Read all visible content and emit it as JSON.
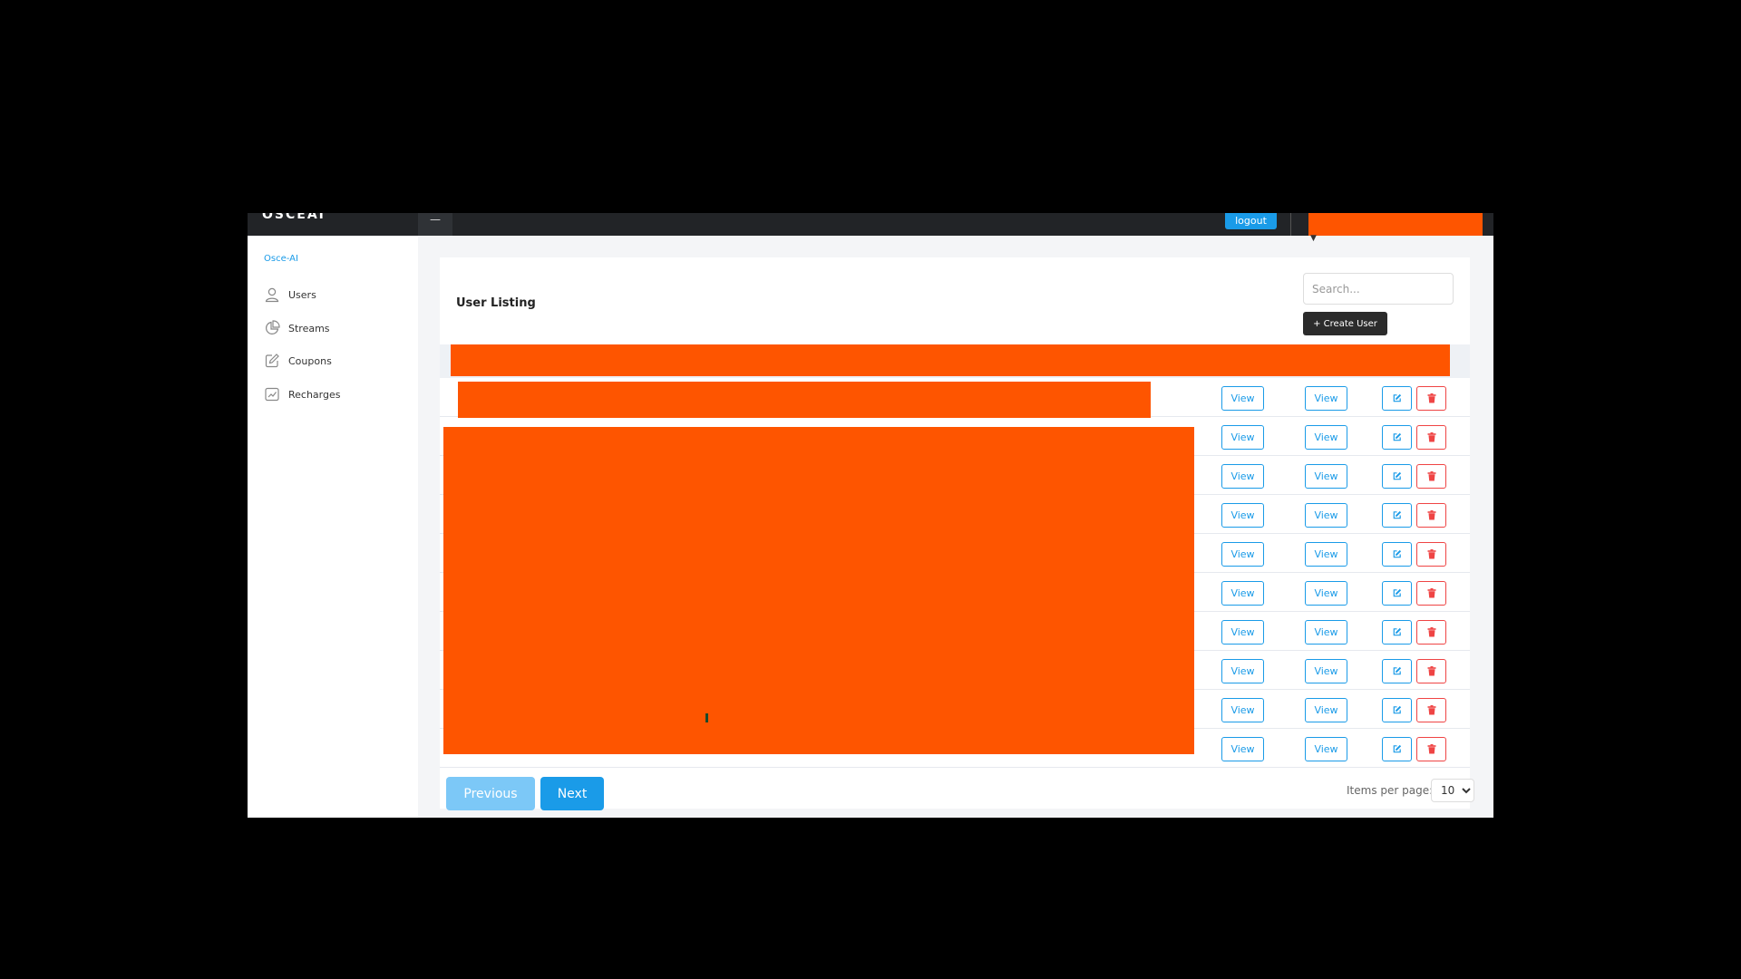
{
  "topbar": {
    "logo": "OSCEAI",
    "menu_icon": "hamburger-icon",
    "logout_label": "logout"
  },
  "sidebar": {
    "brand": "Osce-AI",
    "items": [
      {
        "label": "Users",
        "icon": "user-icon"
      },
      {
        "label": "Streams",
        "icon": "pie-chart-icon"
      },
      {
        "label": "Coupons",
        "icon": "edit-icon"
      },
      {
        "label": "Recharges",
        "icon": "chart-line-icon"
      }
    ]
  },
  "main": {
    "title": "User Listing",
    "search_placeholder": "Search...",
    "create_label": "+ Create User",
    "rows": [
      {
        "view1": "View",
        "view2": "View"
      },
      {
        "view1": "View",
        "view2": "View"
      },
      {
        "view1": "View",
        "view2": "View"
      },
      {
        "view1": "View",
        "view2": "View"
      },
      {
        "view1": "View",
        "view2": "View"
      },
      {
        "view1": "View",
        "view2": "View"
      },
      {
        "view1": "View",
        "view2": "View"
      },
      {
        "view1": "View",
        "view2": "View"
      },
      {
        "view1": "View",
        "view2": "View"
      },
      {
        "view1": "View",
        "view2": "View"
      }
    ]
  },
  "pagination": {
    "prev_label": "Previous",
    "next_label": "Next",
    "items_per_page_label": "Items per page:",
    "items_per_page_value": "10"
  },
  "colors": {
    "accent": "#1a9be8",
    "danger": "#ef4444",
    "redaction": "#fe5500",
    "topbar": "#222427"
  }
}
